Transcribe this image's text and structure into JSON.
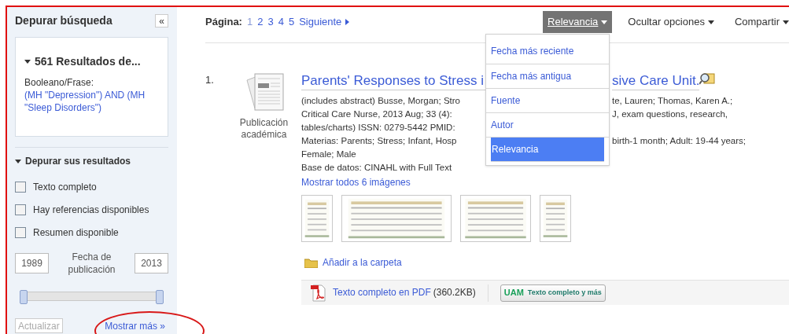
{
  "sidebar": {
    "title": "Depurar búsqueda",
    "collapse_button": "«",
    "query_box": {
      "heading": "561 Resultados de...",
      "expanded": true,
      "label": "Booleano/Frase:",
      "query": "(MH \"Depression\") AND (MH \"Sleep Disorders\")"
    },
    "refine": {
      "heading": "Depurar sus resultados",
      "expanded": true,
      "checkboxes": [
        {
          "label": "Texto completo",
          "checked": false
        },
        {
          "label": "Hay referencias disponibles",
          "checked": false
        },
        {
          "label": "Resumen disponible",
          "checked": false
        }
      ],
      "date_from": "1989",
      "date_label": "Fecha de publicación",
      "date_to": "2013",
      "thumbs": [
        {
          "level": 0
        },
        {
          "level": 1
        }
      ],
      "update_button": {
        "label": "Actualizar",
        "disabled": true
      },
      "more_link": "Mostrar más »"
    }
  },
  "pager": {
    "label": "Página:",
    "pages": [
      {
        "label": "1",
        "selected": true
      },
      {
        "label": "2",
        "selected": false
      },
      {
        "label": "3",
        "selected": false
      },
      {
        "label": "4",
        "selected": false
      },
      {
        "label": "5",
        "selected": false
      }
    ],
    "next": "Siguiente"
  },
  "toolbar": [
    {
      "label": "Relevancia",
      "selected": true
    },
    {
      "label": "Ocultar opciones",
      "selected": false
    },
    {
      "label": "Compartir",
      "selected": false
    }
  ],
  "sort_menu": [
    {
      "label": "Fecha más reciente",
      "selected": false
    },
    {
      "label": "Fecha más antigua",
      "selected": false
    },
    {
      "label": "Fuente",
      "selected": false
    },
    {
      "label": "Autor",
      "selected": false
    },
    {
      "label": "Relevancia",
      "selected": true
    }
  ],
  "result": {
    "number": "1.",
    "type": "Publicación académica",
    "title_left": "Parents' Responses to Stress i",
    "title_right": "sive Care Unit.",
    "lines": [
      {
        "left": "(includes abstract) Busse, Morgan; Stro",
        "right": "te, Lauren; Thomas, Karen A.;"
      },
      {
        "left": "Critical Care Nurse, 2013 Aug; 33 (4):",
        "right": "J, exam questions, research,"
      },
      {
        "left": "tables/charts) ISSN: 0279-5442 PMID:"
      },
      {
        "left": "Materias: Parents; Stress; Infant, Hosp",
        "right": "birth-1 month; Adult: 19-44 years;"
      }
    ],
    "tail_lines": [
      "Female; Male",
      "Base de datos: CINAHL with Full Text"
    ],
    "images_link": "Mostrar todos 6 imágenes",
    "thumbnails": [
      {
        "kind": "picture"
      },
      {
        "kind": "picture"
      },
      {
        "kind": "picture"
      },
      {
        "kind": "picture"
      }
    ],
    "folder_link": "Añadir a la carpeta",
    "pdf_link": "Texto completo en PDF",
    "pdf_size": "(360.2KB)",
    "uam_button": {
      "logo": "UAM",
      "label": "Texto completo y más"
    }
  }
}
